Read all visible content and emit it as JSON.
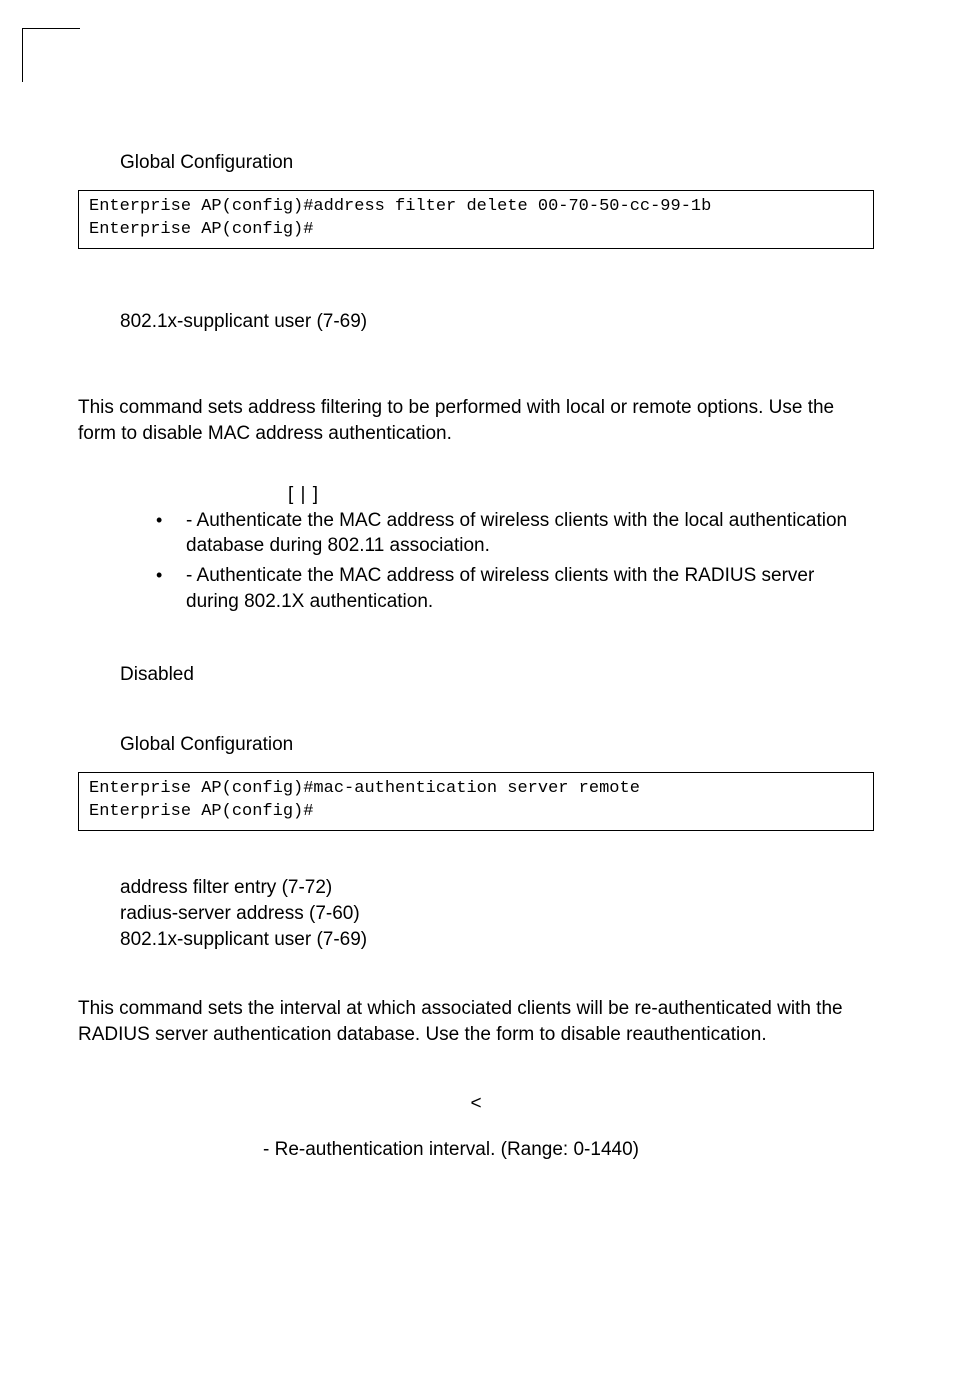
{
  "s1": {
    "cmd_mode": "Global Configuration",
    "code": "Enterprise AP(config)#address filter delete 00-70-50-cc-99-1b\nEnterprise AP(config)#",
    "related": "802.1x-supplicant user (7-69)"
  },
  "s2": {
    "desc": "This command sets address filtering to be performed with local or remote options. Use the       form to disable MAC address authentication.",
    "syntax": "[         |             ]",
    "opt_local": "        - Authenticate the MAC address of wireless clients with the local authentication database during 802.11 association.",
    "opt_remote": "           - Authenticate the MAC address of wireless clients with the RADIUS server during 802.1X authentication.",
    "default": "Disabled",
    "cmd_mode": "Global Configuration",
    "code": "Enterprise AP(config)#mac-authentication server remote\nEnterprise AP(config)#",
    "related1": "address filter entry (7-72)",
    "related2": "radius-server address (7-60)",
    "related3": "802.1x-supplicant user (7-69)"
  },
  "s3": {
    "desc": "This command sets the interval at which associated clients will be re-authenticated with the RADIUS server authentication database. Use the       form to disable reauthentication.",
    "syntax": "<",
    "param": "- Re-authentication interval. (Range: 0-1440)"
  }
}
